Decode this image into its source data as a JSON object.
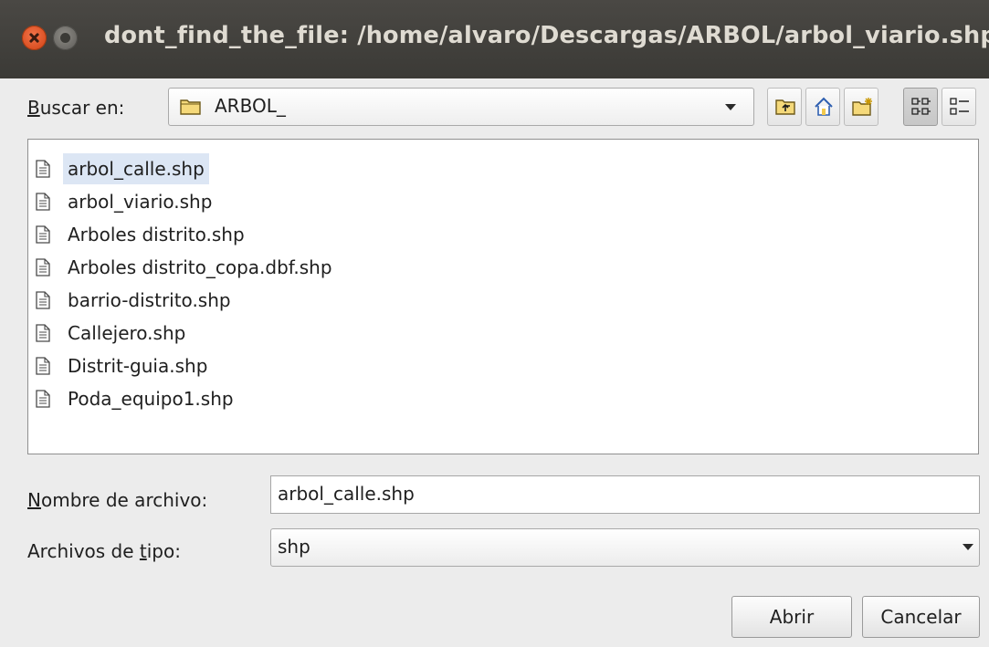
{
  "window": {
    "title": "dont_find_the_file: /home/alvaro/Descargas/ARBOL/arbol_viario.shp"
  },
  "look_in": {
    "label_accel": "B",
    "label_rest": "uscar en:",
    "current_folder": "ARBOL_"
  },
  "toolbar": {
    "buttons": [
      "up-folder-icon",
      "home-icon",
      "new-folder-icon",
      "list-view-icon",
      "details-view-icon"
    ],
    "active": "list-view-icon"
  },
  "files": [
    {
      "name": "arbol_calle.shp",
      "selected": true
    },
    {
      "name": "arbol_viario.shp"
    },
    {
      "name": "Arboles distrito.shp"
    },
    {
      "name": "Arboles distrito_copa.dbf.shp"
    },
    {
      "name": "barrio-distrito.shp"
    },
    {
      "name": "Callejero.shp"
    },
    {
      "name": "Distrit-guia.shp"
    },
    {
      "name": "Poda_equipo1.shp"
    }
  ],
  "filename": {
    "label_accel": "N",
    "label_rest": "ombre de archivo:",
    "value": "arbol_calle.shp"
  },
  "filetype": {
    "label_before": "Archivos de ",
    "label_accel": "t",
    "label_after": "ipo:",
    "value": "shp"
  },
  "actions": {
    "open": "Abrir",
    "cancel": "Cancelar"
  },
  "colors": {
    "titlebar": "#3c3b37",
    "close_button": "#e8572a",
    "selection": "#dce6f4",
    "dialog_bg": "#ececec"
  }
}
